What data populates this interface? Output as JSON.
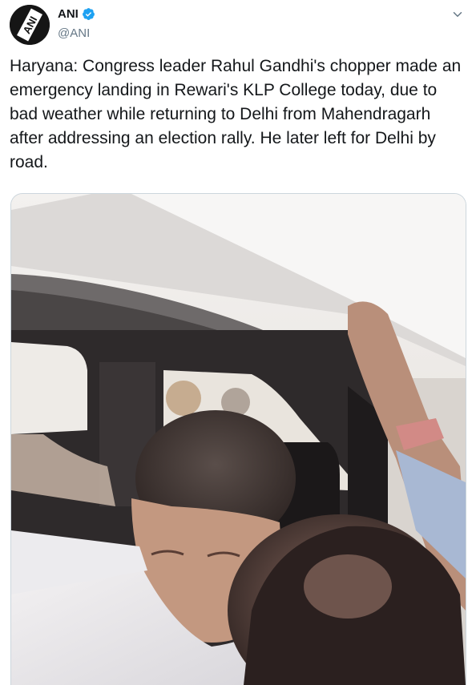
{
  "account": {
    "display_name": "ANI",
    "handle": "@ANI",
    "avatar_text": "ANI",
    "verified": true,
    "verified_color": "#1da1f2"
  },
  "tweet": {
    "text": "Haryana: Congress leader Rahul Gandhi's chopper made an emergency landing in Rewari's KLP College today, due to bad weather while returning to Delhi from Mahendragarh after addressing an election rally. He later left for Delhi by road."
  },
  "icons": {
    "menu": "chevron-down-icon",
    "verified": "verified-badge-icon"
  },
  "colors": {
    "text": "#14171a",
    "secondary": "#657786",
    "border": "#ccd6dd"
  }
}
